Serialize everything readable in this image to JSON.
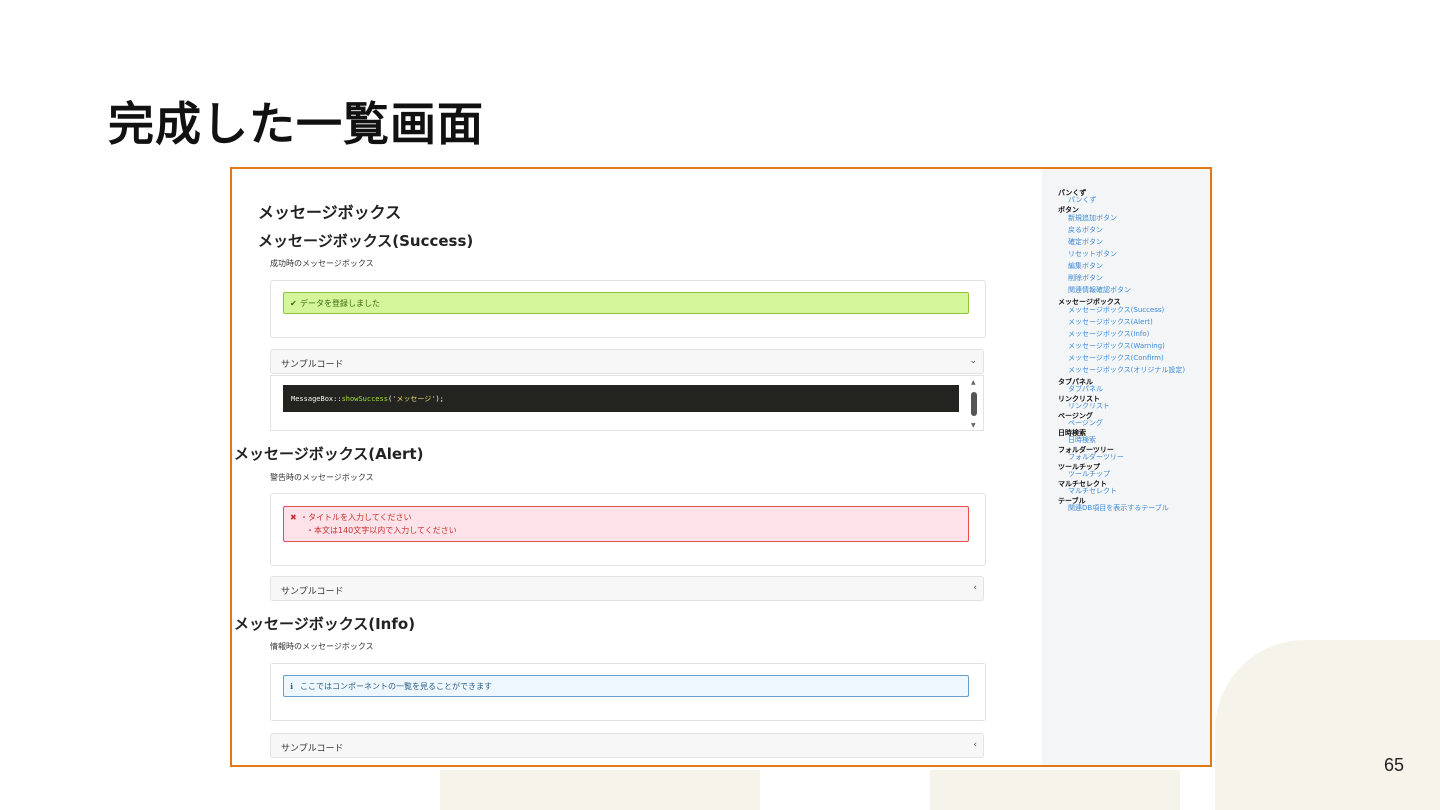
{
  "slide": {
    "title": "完成した一覧画面",
    "page_number": "65"
  },
  "page": {
    "heading": "メッセージボックス",
    "sections": [
      {
        "title": "メッセージボックス(Success)",
        "description": "成功時のメッセージボックス",
        "message_icon": "check-circle-icon",
        "message_lines": [
          "データを登録しました"
        ],
        "accordion_label": "サンプルコード",
        "accordion_state": "expanded",
        "code": {
          "class_name": "MessageBox",
          "separator": "::",
          "method": "showSuccess",
          "open": "(",
          "argument": "'メッセージ'",
          "close": ");"
        }
      },
      {
        "title": "メッセージボックス(Alert)",
        "description": "警告時のメッセージボックス",
        "message_icon": "x-icon",
        "message_lines": [
          "・タイトルを入力してください",
          "・本文は140文字以内で入力してください"
        ],
        "accordion_label": "サンプルコード",
        "accordion_state": "collapsed"
      },
      {
        "title": "メッセージボックス(Info)",
        "description": "情報時のメッセージボックス",
        "message_icon": "info-circle-icon",
        "message_lines": [
          "ここではコンポーネントの一覧を見ることができます"
        ],
        "accordion_label": "サンプルコード",
        "accordion_state": "collapsed"
      }
    ]
  },
  "sidebar": {
    "groups": [
      {
        "label": "パンくず",
        "items": [
          "パンくず"
        ]
      },
      {
        "label": "ボタン",
        "items": [
          "新規追加ボタン",
          "戻るボタン",
          "確定ボタン",
          "リセットボタン",
          "編集ボタン",
          "削除ボタン",
          "関連情報確認ボタン"
        ]
      },
      {
        "label": "メッセージボックス",
        "items": [
          "メッセージボックス(Success)",
          "メッセージボックス(Alert)",
          "メッセージボックス(Info)",
          "メッセージボックス(Warning)",
          "メッセージボックス(Confirm)",
          "メッセージボックス(オリジナル設定)"
        ]
      },
      {
        "label": "タブパネル",
        "items": [
          "タブパネル"
        ]
      },
      {
        "label": "リンクリスト",
        "items": [
          "リンクリスト"
        ]
      },
      {
        "label": "ページング",
        "items": [
          "ページング"
        ]
      },
      {
        "label": "日時検索",
        "items": [
          "日時検索"
        ]
      },
      {
        "label": "フォルダーツリー",
        "items": [
          "フォルダーツリー"
        ]
      },
      {
        "label": "ツールチップ",
        "items": [
          "ツールチップ"
        ]
      },
      {
        "label": "マルチセレクト",
        "items": [
          "マルチセレクト"
        ]
      },
      {
        "label": "テーブル",
        "items": [
          "関連DB項目を表示するテーブル"
        ]
      }
    ]
  },
  "colors": {
    "frame_border": "#e07818",
    "success_bg": "#d4f59a",
    "danger_bg": "#fde2ea",
    "info_border": "#6a9ec8",
    "link": "#3a8ad8"
  }
}
